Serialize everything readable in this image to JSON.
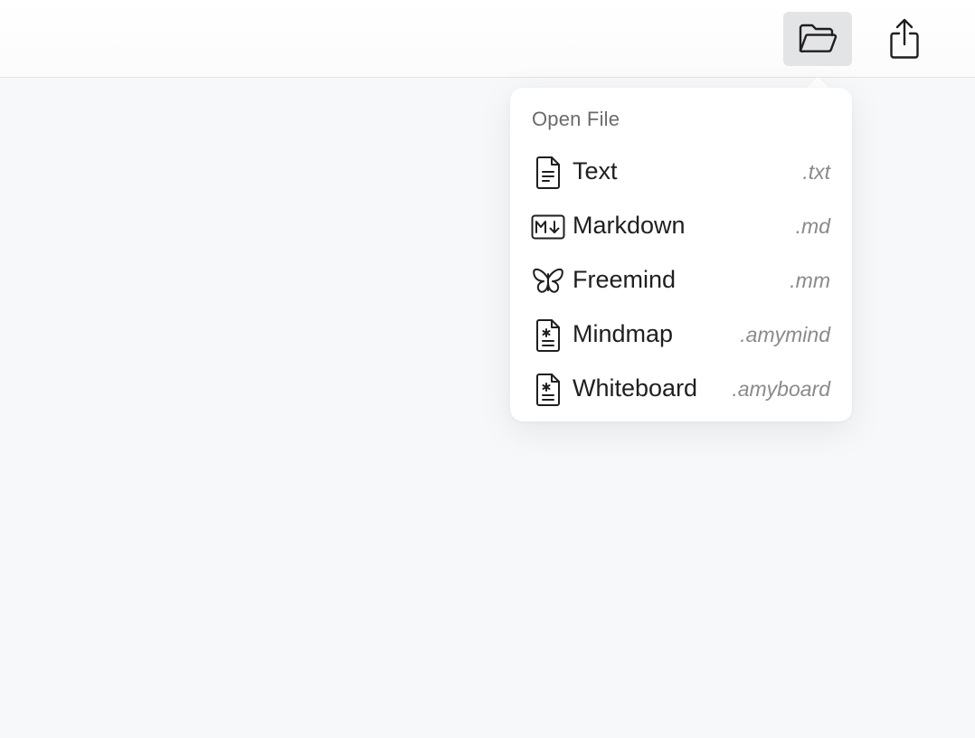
{
  "toolbar": {
    "buttons": [
      {
        "id": "open",
        "icon": "folder-open-icon",
        "active": true
      },
      {
        "id": "share",
        "icon": "share-icon",
        "active": false
      }
    ]
  },
  "open_menu": {
    "title": "Open File",
    "items": [
      {
        "label": "Text",
        "extension": ".txt",
        "icon": "text-file-icon"
      },
      {
        "label": "Markdown",
        "extension": ".md",
        "icon": "markdown-icon"
      },
      {
        "label": "Freemind",
        "extension": ".mm",
        "icon": "butterfly-icon"
      },
      {
        "label": "Mindmap",
        "extension": ".amymind",
        "icon": "asterisk-file-icon"
      },
      {
        "label": "Whiteboard",
        "extension": ".amyboard",
        "icon": "asterisk-file-icon"
      }
    ]
  },
  "colors": {
    "background": "#f7f8fa",
    "toolbar": "#ffffff",
    "active_button": "#e3e4e6",
    "popover": "#ffffff",
    "label_text": "#1f1f1f",
    "muted_text": "#8a8a8a",
    "title_text": "#6b6b6b"
  }
}
